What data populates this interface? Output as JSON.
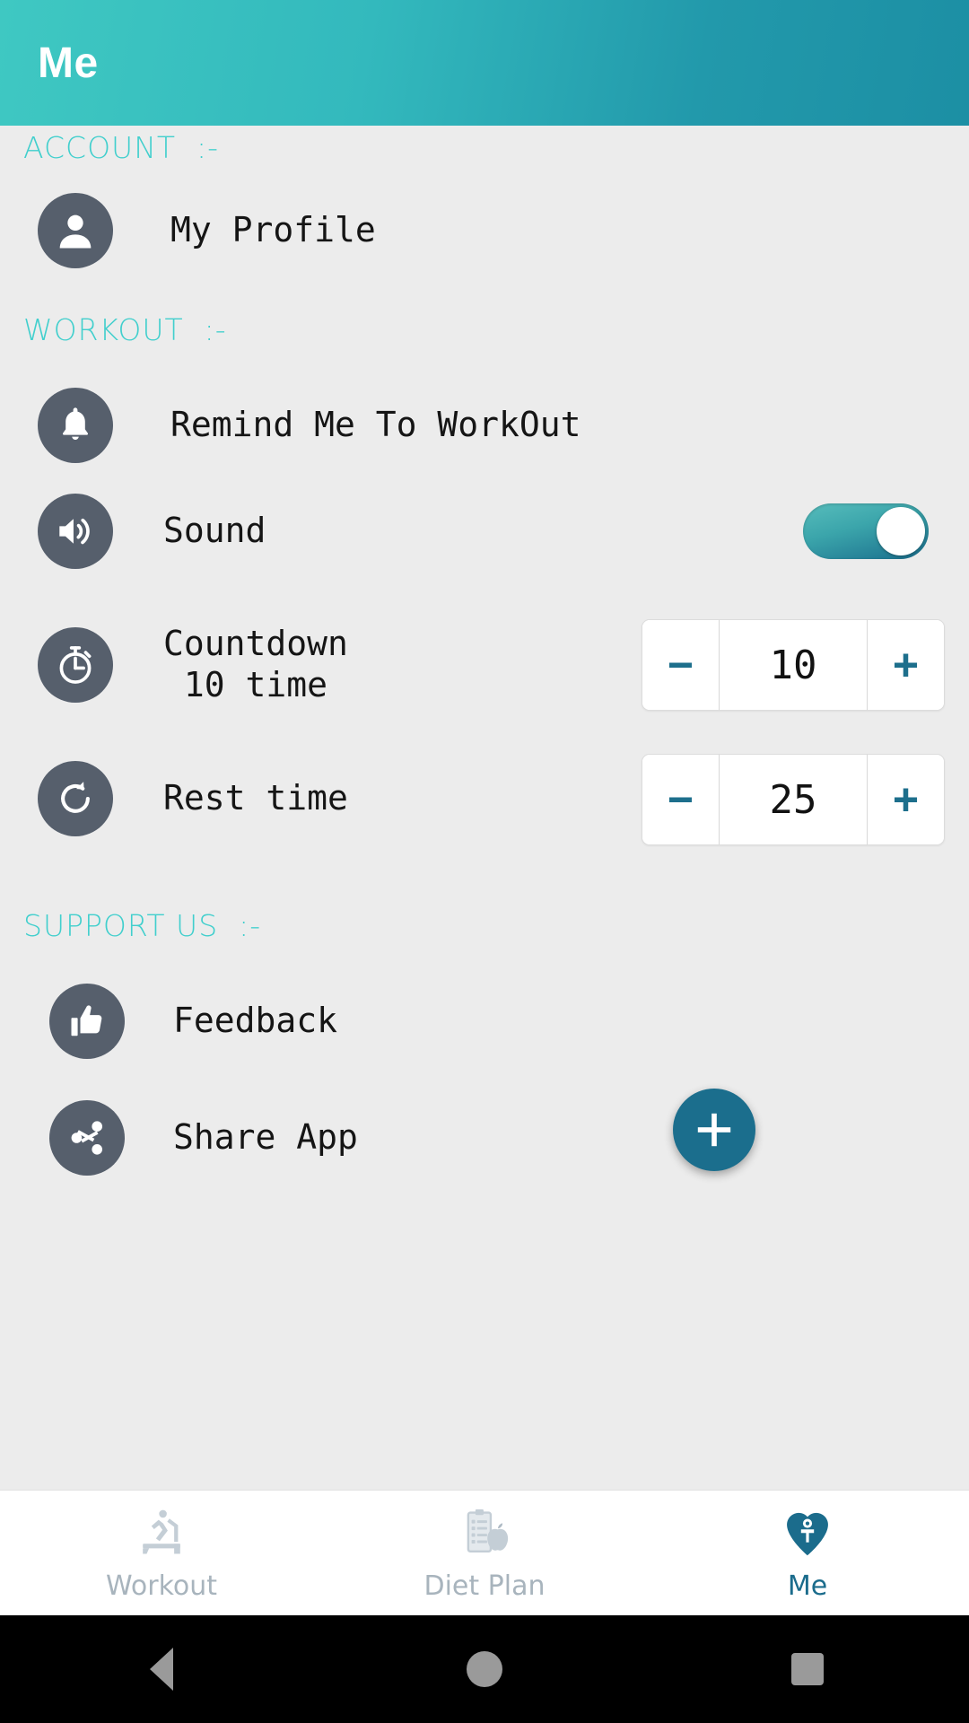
{
  "appbar": {
    "title": "Me"
  },
  "sections": {
    "account": {
      "header": "ACCOUNT  :-"
    },
    "workout": {
      "header": "WORKOUT  :-"
    },
    "support": {
      "header": "SUPPORT US  :-"
    }
  },
  "rows": {
    "profile": {
      "label": "My Profile",
      "icon": "person-icon"
    },
    "remind": {
      "label": "Remind Me To WorkOut",
      "icon": "bell-icon"
    },
    "sound": {
      "label": "Sound",
      "icon": "speaker-icon",
      "toggle_state": "on"
    },
    "countdown": {
      "label_line1": "Countdown",
      "label_line2": " 10 time",
      "icon": "stopwatch-icon",
      "value": "10",
      "minus": "−",
      "plus": "+"
    },
    "rest": {
      "label": "Rest time",
      "icon": "refresh-icon",
      "value": "25",
      "minus": "−",
      "plus": "+"
    },
    "feedback": {
      "label": "Feedback",
      "icon": "thumbs-up-icon"
    },
    "share": {
      "label": "Share App",
      "icon": "share-icon"
    }
  },
  "fab": {
    "icon": "plus-icon",
    "label": "+"
  },
  "bottom_nav": {
    "items": [
      {
        "label": "Workout",
        "icon": "treadmill-icon",
        "active": false
      },
      {
        "label": "Diet Plan",
        "icon": "clipboard-apple-icon",
        "active": false
      },
      {
        "label": "Me",
        "icon": "heart-person-icon",
        "active": true
      }
    ]
  },
  "system_nav": {
    "back": "back-triangle-icon",
    "home": "home-circle-icon",
    "recents": "recents-square-icon"
  },
  "colors": {
    "appbar_gradient_start": "#3fc8c2",
    "appbar_gradient_end": "#1c8fa4",
    "section_header": "#41cfcd",
    "icon_circle": "#565f6c",
    "accent_dark": "#1b6e8d",
    "page_bg": "#ececec",
    "nav_inactive": "#a8b4bd"
  }
}
